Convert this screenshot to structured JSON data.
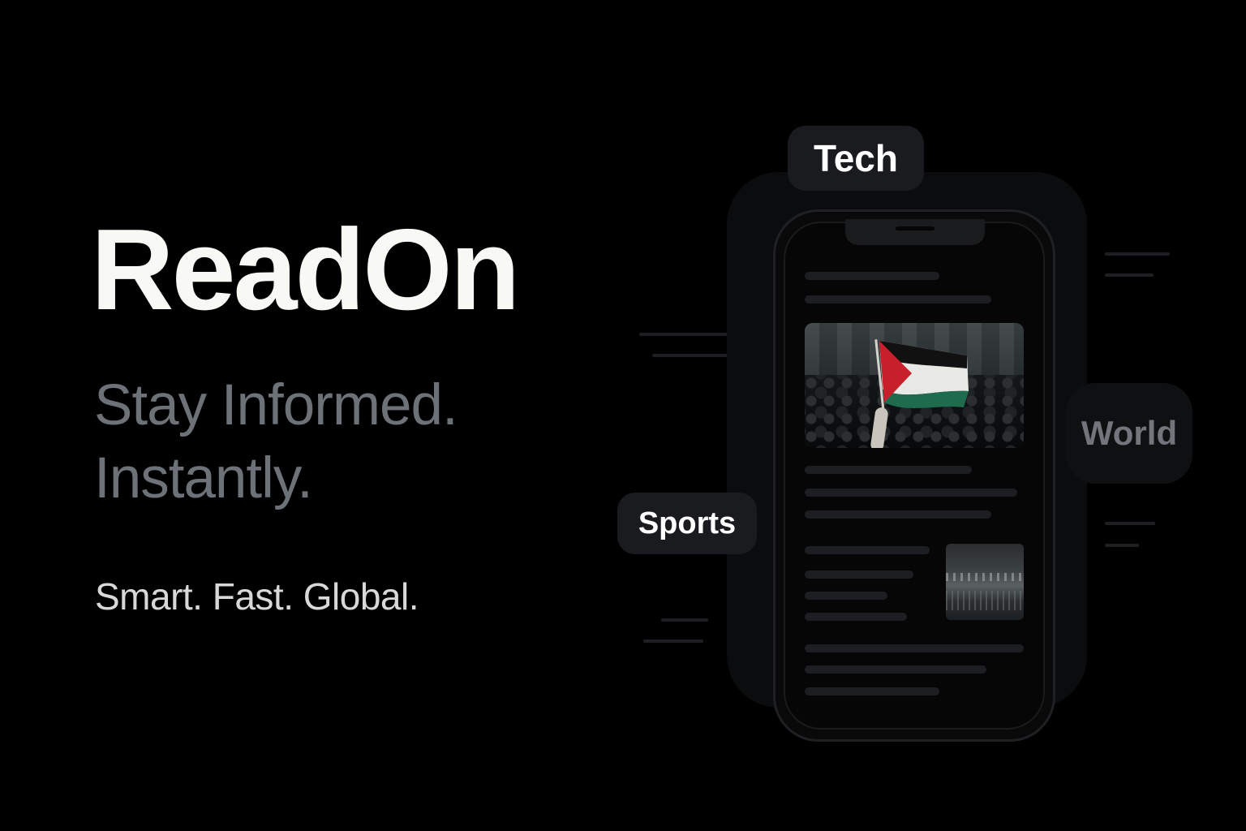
{
  "app": {
    "name": "ReadOn",
    "tagline_line1": "Stay Informed.",
    "tagline_line2": "Instantly.",
    "motto": "Smart. Fast. Global."
  },
  "categories": {
    "tech": "Tech",
    "sports": "Sports",
    "world": "World"
  },
  "colors": {
    "background": "#000000",
    "brand_text": "#f8f8f4",
    "tagline_text": "#6d7178",
    "chip_background": "#1a1b1e",
    "flag_black": "#111111",
    "flag_white": "#e8e8e4",
    "flag_green": "#1f6b4e",
    "flag_red": "#c8202a"
  },
  "images": {
    "hero_article_image": "crowd-with-flag-photo",
    "secondary_article_thumbnail": "stadium-photo"
  }
}
